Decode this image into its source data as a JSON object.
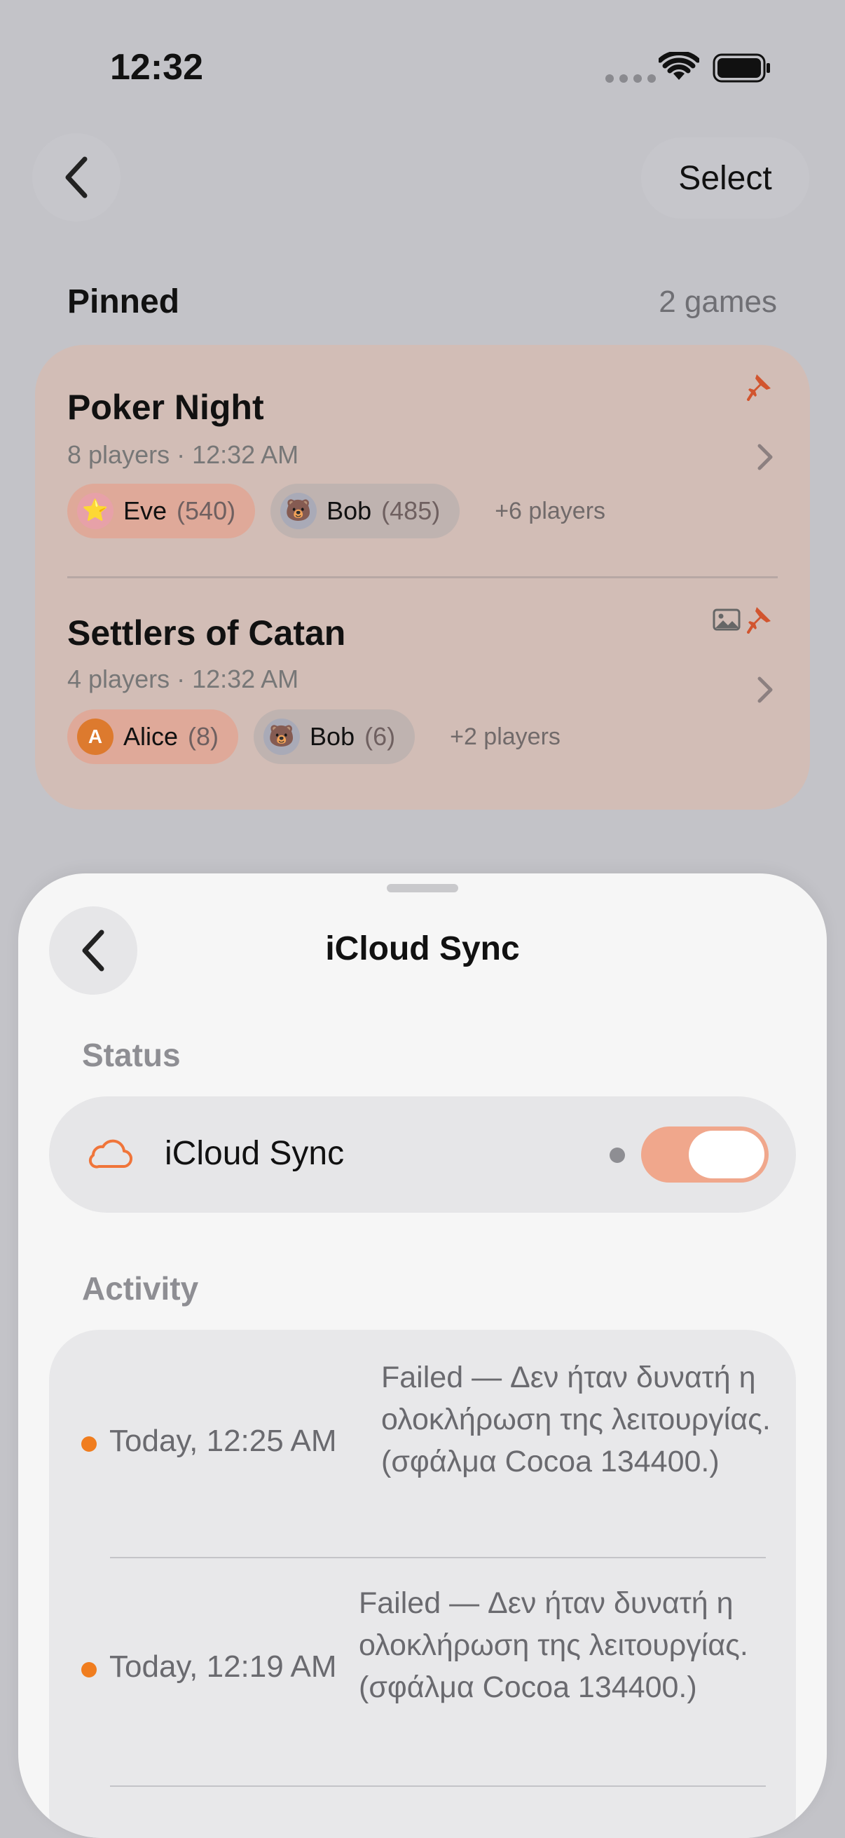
{
  "status_bar": {
    "time": "12:32",
    "icons": [
      "signal-dots-icon",
      "wifi-icon",
      "battery-icon"
    ]
  },
  "nav": {
    "back_icon": "chevron-left-icon",
    "select_label": "Select"
  },
  "pinned": {
    "title": "Pinned",
    "count": "2 games",
    "games": [
      {
        "title": "Poker Night",
        "meta": "8 players · 12:32 AM",
        "players": [
          {
            "avatar": "⭐",
            "name": "Eve",
            "score": "(540)"
          },
          {
            "avatar": "🐻",
            "name": "Bob",
            "score": "(485)"
          }
        ],
        "more": "+6 players",
        "icons": [
          "pin-icon",
          "chevron-right-icon"
        ]
      },
      {
        "title": "Settlers of Catan",
        "meta": "4 players · 12:32 AM",
        "players": [
          {
            "avatar": "A",
            "name": "Alice",
            "score": "(8)"
          },
          {
            "avatar": "🐻",
            "name": "Bob",
            "score": "(6)"
          }
        ],
        "more": "+2 players",
        "icons": [
          "photo-icon",
          "pin-icon",
          "chevron-right-icon"
        ]
      }
    ]
  },
  "sheet": {
    "title": "iCloud Sync",
    "status_label": "Status",
    "sync": {
      "icon": "cloud-icon",
      "label": "iCloud Sync",
      "enabled": true
    },
    "activity_label": "Activity",
    "activity": [
      {
        "time": "Today, 12:25 AM",
        "message": "Failed — Δεν ήταν δυνατή η ολοκλήρωση της λειτουργίας. (σφάλμα Cocoa 134400.)"
      },
      {
        "time": "Today, 12:19 AM",
        "message": "Failed — Δεν ήταν δυνατή η ολοκλήρωση της λειτουργίας. (σφάλμα Cocoa 134400.)"
      }
    ]
  },
  "colors": {
    "accent": "#f0a78c",
    "pin": "#d2552f",
    "failed_dot": "#f07d1f",
    "pinned_card": "#d2bdb6"
  }
}
